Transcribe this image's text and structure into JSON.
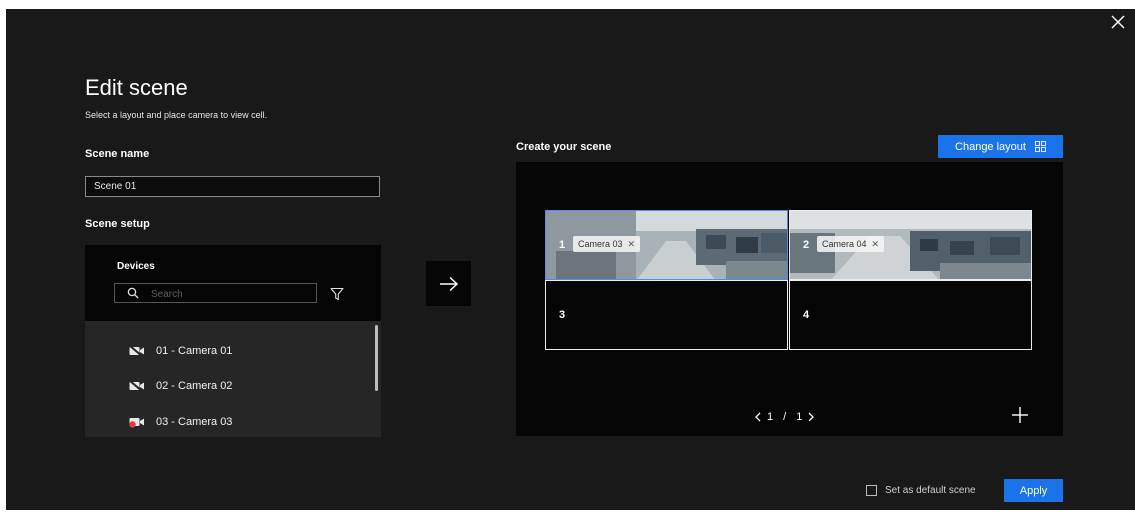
{
  "dialog": {
    "title": "Edit scene",
    "subtitle": "Select a layout and place camera to view cell."
  },
  "scene_name": {
    "label": "Scene name",
    "value": "Scene 01"
  },
  "scene_setup": {
    "label": "Scene setup",
    "devices_title": "Devices",
    "search_placeholder": "Search",
    "items": [
      {
        "label": "01 - Camera 01",
        "status": "offline",
        "icon": "camera-off-icon"
      },
      {
        "label": "02 - Camera 02",
        "status": "offline",
        "icon": "camera-off-icon"
      },
      {
        "label": "03 - Camera 03",
        "status": "recording",
        "icon": "camera-recording-icon"
      }
    ]
  },
  "create_scene": {
    "label": "Create your scene",
    "change_layout_label": "Change layout",
    "cells": [
      {
        "number": "1",
        "camera": "Camera 03",
        "has_feed": true,
        "selected": true
      },
      {
        "number": "2",
        "camera": "Camera 04",
        "has_feed": true,
        "selected": false
      },
      {
        "number": "3",
        "camera": "",
        "has_feed": false,
        "selected": false
      },
      {
        "number": "4",
        "camera": "",
        "has_feed": false,
        "selected": false
      }
    ],
    "pager": {
      "current": "1",
      "total": "1",
      "separator": "/"
    }
  },
  "footer": {
    "default_label": "Set as default scene",
    "default_checked": false,
    "apply_label": "Apply"
  },
  "colors": {
    "accent": "#1a73e8",
    "background": "#191919",
    "panel": "#050505",
    "list_background": "#262626",
    "recording": "#e53935"
  }
}
